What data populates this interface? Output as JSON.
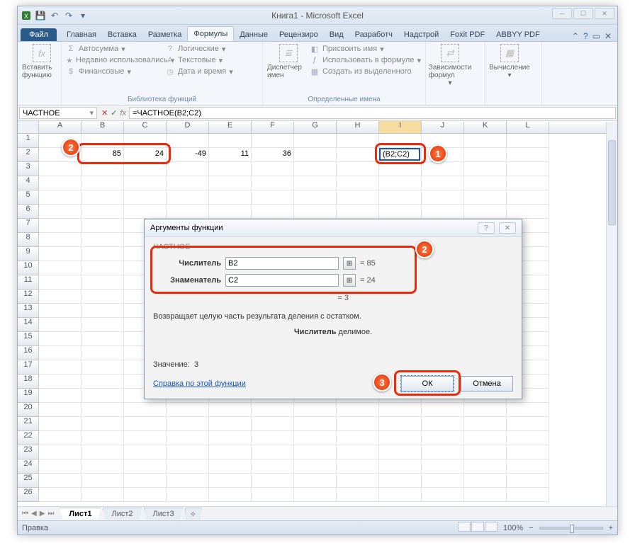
{
  "title": "Книга1 - Microsoft Excel",
  "tabs": {
    "file": "Файл",
    "home": "Главная",
    "insert": "Вставка",
    "layout": "Разметка",
    "formulas": "Формулы",
    "data": "Данные",
    "review": "Рецензиро",
    "view": "Вид",
    "dev": "Разработч",
    "add": "Надстрой",
    "foxit": "Foxit PDF",
    "abby": "ABBYY PDF"
  },
  "ribbon": {
    "insert_fn": "Вставить функцию",
    "autosum": "Автосумма",
    "recent": "Недавно использовались",
    "finance": "Финансовые",
    "logic": "Логические",
    "text": "Текстовые",
    "datetime": "Дата и время",
    "group_lib": "Библиотека функций",
    "nm": "Диспетчер имен",
    "assign": "Присвоить имя",
    "use": "Использовать в формуле",
    "create": "Создать из выделенного",
    "group_names": "Определенные имена",
    "deps": "Зависимости формул",
    "calc": "Вычисление"
  },
  "namebox": "ЧАСТНОЕ",
  "formula": "=ЧАСТНОЕ(B2;C2)",
  "cols": [
    "A",
    "B",
    "C",
    "D",
    "E",
    "F",
    "G",
    "H",
    "I",
    "J",
    "K",
    "L"
  ],
  "row2": {
    "B": "85",
    "C": "24",
    "D": "-49",
    "E": "11",
    "F": "36",
    "I": "(B2;C2)"
  },
  "dialog": {
    "title": "Аргументы функции",
    "fn": "ЧАСТНОЕ",
    "arg1_label": "Числитель",
    "arg1_val": "B2",
    "arg1_res": "= 85",
    "arg2_label": "Знаменатель",
    "arg2_val": "C2",
    "arg2_res": "= 24",
    "result": "= 3",
    "desc": "Возвращает целую часть результата деления с остатком.",
    "desc2_b": "Числитель",
    "desc2_t": "   делимое.",
    "val_label": "Значение:",
    "val": "3",
    "help": "Справка по этой функции",
    "ok": "ОК",
    "cancel": "Отмена"
  },
  "sheets": {
    "s1": "Лист1",
    "s2": "Лист2",
    "s3": "Лист3"
  },
  "status": {
    "mode": "Правка",
    "zoom": "100%"
  }
}
